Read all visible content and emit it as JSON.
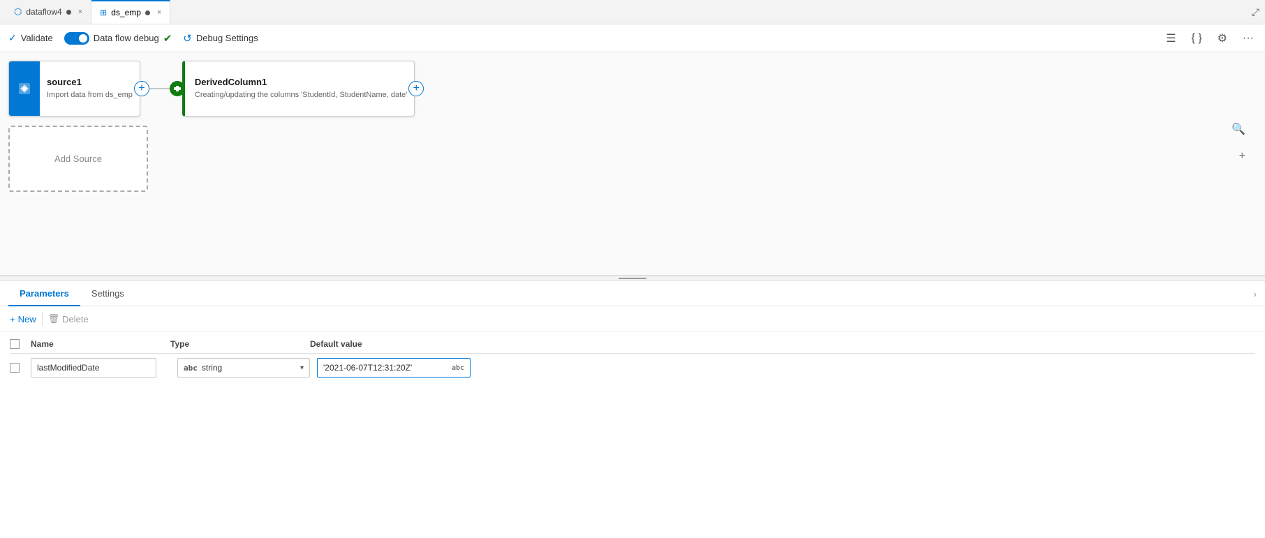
{
  "tabs": [
    {
      "id": "dataflow4",
      "label": "dataflow4",
      "icon": "df",
      "active": false,
      "dot": true
    },
    {
      "id": "ds_emp",
      "label": "ds_emp",
      "icon": "table",
      "active": true,
      "dot": true
    }
  ],
  "toolbar": {
    "validate_label": "Validate",
    "data_flow_debug_label": "Data flow debug",
    "debug_settings_label": "Debug Settings"
  },
  "canvas": {
    "source_node": {
      "title": "source1",
      "description": "Import data from ds_emp"
    },
    "derived_node": {
      "title": "DerivedColumn1",
      "description": "Creating/updating the columns 'StudentId, StudentName, date'"
    },
    "add_source_label": "Add Source"
  },
  "bottom_panel": {
    "tabs": [
      {
        "id": "parameters",
        "label": "Parameters",
        "active": true
      },
      {
        "id": "settings",
        "label": "Settings",
        "active": false
      }
    ],
    "toolbar": {
      "new_label": "New",
      "delete_label": "Delete"
    },
    "table": {
      "headers": [
        {
          "id": "name",
          "label": "Name"
        },
        {
          "id": "type",
          "label": "Type"
        },
        {
          "id": "default_value",
          "label": "Default value"
        }
      ],
      "rows": [
        {
          "name": "lastModifiedDate",
          "type": "string",
          "type_prefix": "abc",
          "default_value": "'2021-06-07T12:31:20Z'",
          "default_badge": "abc"
        }
      ]
    }
  },
  "icons": {
    "validate": "✓",
    "debug_settings": "⚙",
    "new_plus": "+",
    "delete_trash": "🗑",
    "chevron_down": "▾",
    "search": "🔍",
    "expand": "+",
    "columns_icon": "☰",
    "code_icon": "{ }",
    "filter_icon": "⚙"
  }
}
